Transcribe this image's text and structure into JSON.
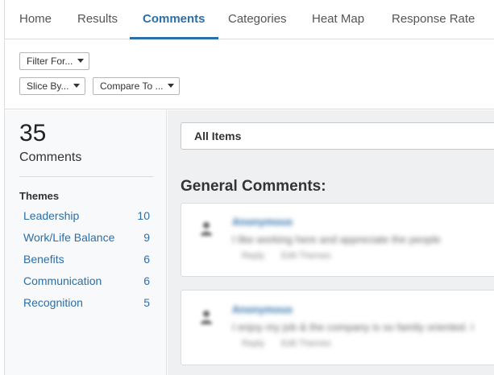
{
  "tabs": [
    {
      "label": "Home",
      "active": false
    },
    {
      "label": "Results",
      "active": false
    },
    {
      "label": "Comments",
      "active": true
    },
    {
      "label": "Categories",
      "active": false
    },
    {
      "label": "Heat Map",
      "active": false
    },
    {
      "label": "Response Rate",
      "active": false
    }
  ],
  "filters": {
    "filter_for": "Filter For...",
    "slice_by": "Slice By...",
    "compare_to": "Compare To ..."
  },
  "summary": {
    "count": "35",
    "label": "Comments"
  },
  "themes": {
    "heading": "Themes",
    "items": [
      {
        "label": "Leadership",
        "count": "10"
      },
      {
        "label": "Work/Life Balance",
        "count": "9"
      },
      {
        "label": "Benefits",
        "count": "6"
      },
      {
        "label": "Communication",
        "count": "6"
      },
      {
        "label": "Recognition",
        "count": "5"
      }
    ]
  },
  "main": {
    "item_filter": "All Items",
    "section_title": "General Comments:",
    "comments": [
      {
        "author": "Anonymous",
        "text": "I like working here and appreciate the people",
        "reply": "Reply",
        "edit": "Edit Themes"
      },
      {
        "author": "Anonymous",
        "text": "I enjoy my job & the company is so family oriented. I",
        "reply": "Reply",
        "edit": "Edit Themes"
      }
    ]
  },
  "colors": {
    "accent": "#2c6ea8",
    "panel_bg": "#eef0f2",
    "sidebar_bg": "#f7f9fb"
  }
}
